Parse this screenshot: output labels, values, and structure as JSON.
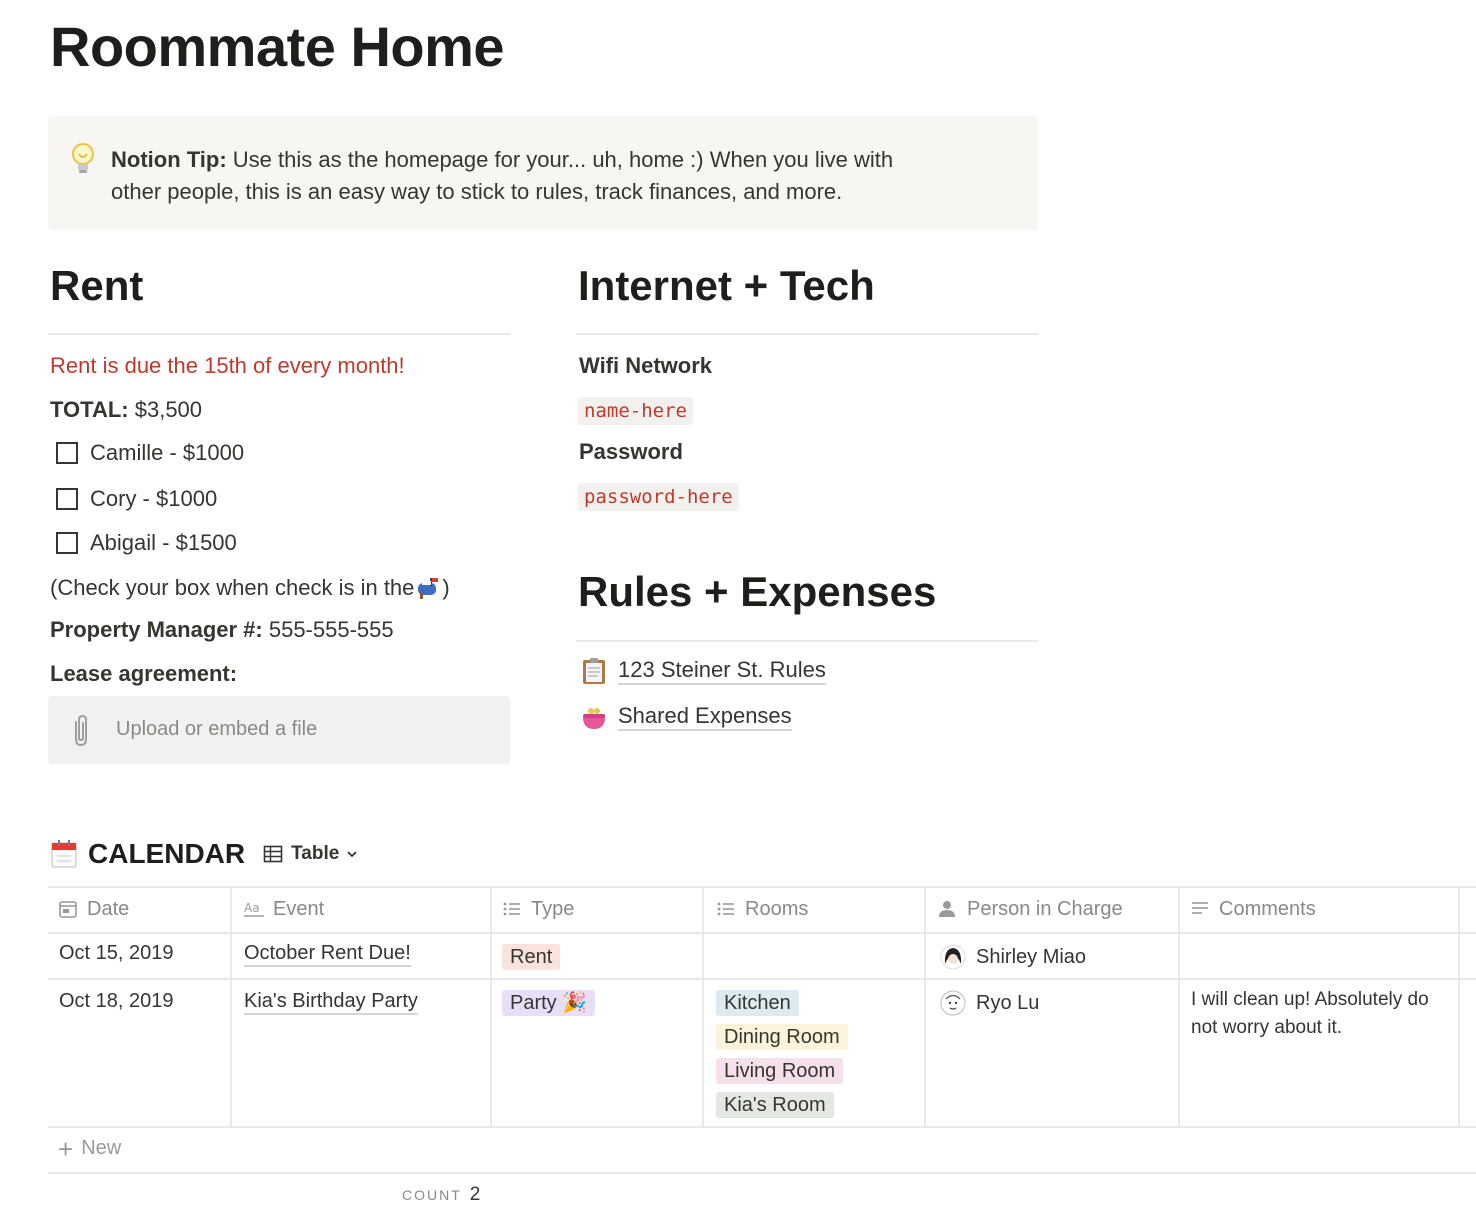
{
  "page": {
    "title": "Roommate Home"
  },
  "callout": {
    "icon": "lightbulb-icon",
    "bold": "Notion Tip:",
    "line1": " Use this as the homepage for your... uh, home :) When you live with",
    "line2": "other people, this is an easy way to stick to rules, track finances, and more."
  },
  "rent": {
    "heading": "Rent",
    "due_note": "Rent is due the 15th of every month!",
    "total_label": "TOTAL:",
    "total_value": " $3,500",
    "todos": [
      {
        "label": "Camille - $1000",
        "checked": false
      },
      {
        "label": "Cory - $1000",
        "checked": false
      },
      {
        "label": "Abigail - $1500",
        "checked": false
      }
    ],
    "check_note_a": "(Check your box when check is in the ",
    "check_note_icon": "mailbox-icon",
    "check_note_b": ")",
    "pm_label": "Property Manager #:",
    "pm_value": " 555-555-555",
    "lease_label": "Lease agreement:",
    "upload_label": "Upload or embed a file"
  },
  "internet": {
    "heading": "Internet + Tech",
    "wifi_label": "Wifi Network",
    "wifi_value": "name-here",
    "password_label": "Password",
    "password_value": "password-here"
  },
  "rules": {
    "heading": "Rules + Expenses",
    "links": [
      {
        "icon": "clipboard-icon",
        "label": "123 Steiner St. Rules"
      },
      {
        "icon": "purse-icon",
        "label": "Shared Expenses"
      }
    ]
  },
  "calendar": {
    "icon": "calendar-icon",
    "title": "CALENDAR",
    "view_label": "Table",
    "columns": [
      {
        "label": "Date",
        "icon": "calendar-property-icon"
      },
      {
        "label": "Event",
        "icon": "text-title-icon"
      },
      {
        "label": "Type",
        "icon": "list-icon"
      },
      {
        "label": "Rooms",
        "icon": "list-icon"
      },
      {
        "label": "Person in Charge",
        "icon": "person-icon"
      },
      {
        "label": "Comments",
        "icon": "text-lines-icon"
      }
    ],
    "rows": [
      {
        "date": "Oct 15, 2019",
        "event": "October Rent Due!",
        "type": {
          "label": "Rent",
          "color": "#fae3dd"
        },
        "rooms": [],
        "person": "Shirley Miao",
        "comment": ""
      },
      {
        "date": "Oct 18, 2019",
        "event": "Kia's Birthday Party",
        "type": {
          "label": "Party 🎉",
          "color": "#e9defa"
        },
        "rooms": [
          {
            "label": "Kitchen",
            "color": "#ddebf1"
          },
          {
            "label": "Dining Room",
            "color": "#fbf3db"
          },
          {
            "label": "Living Room",
            "color": "#f4dfeb"
          },
          {
            "label": "Kia's Room",
            "color": "#e3e8e3"
          }
        ],
        "person": "Ryo Lu",
        "comment": "I will clean up! Absolutely do not worry about it."
      }
    ],
    "new_label": "New",
    "count_label": "COUNT",
    "count_value": "2"
  }
}
